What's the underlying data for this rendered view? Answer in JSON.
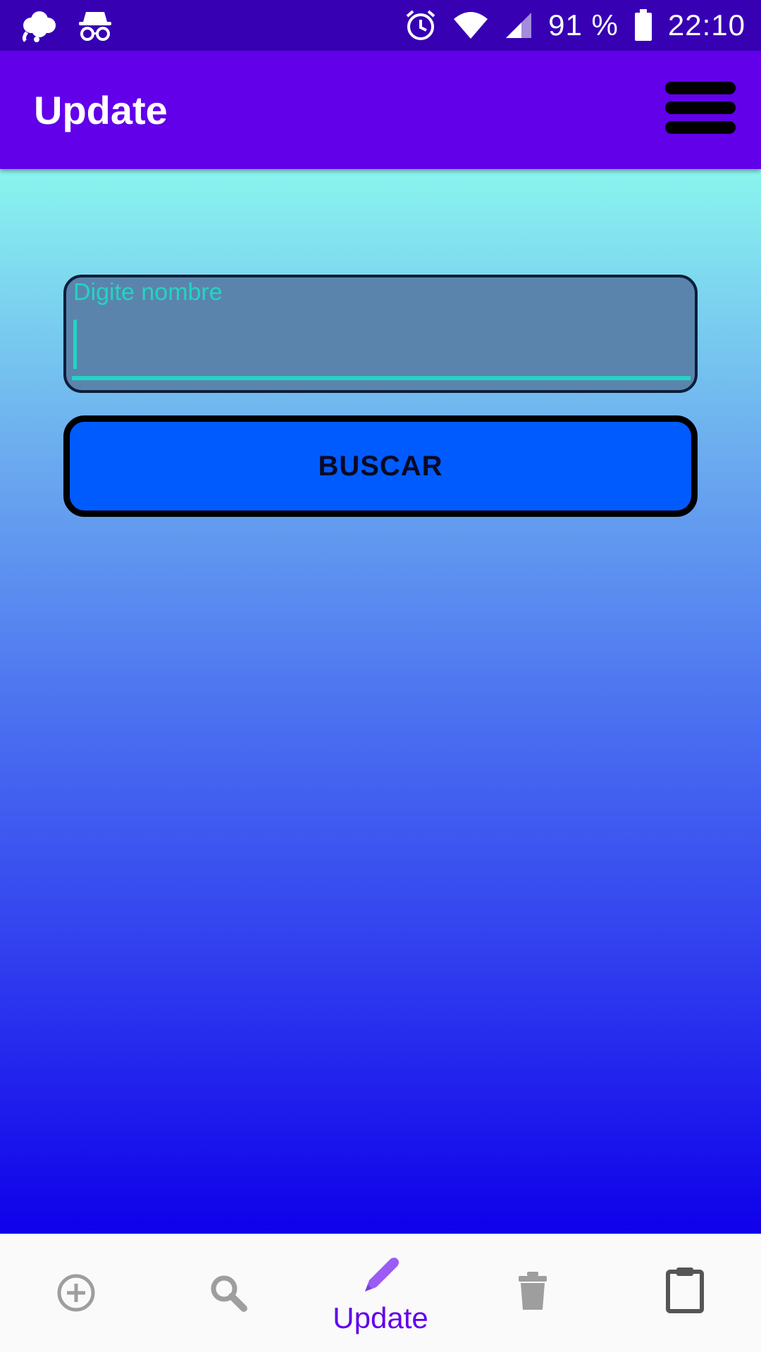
{
  "status_bar": {
    "battery_percent": "91 %",
    "time": "22:10",
    "icons": [
      "flower-notification-icon",
      "incognito-icon",
      "alarm-icon",
      "wifi-icon",
      "signal-icon",
      "battery-icon"
    ]
  },
  "app_bar": {
    "title": "Update",
    "menu_icon": "hamburger-menu-icon"
  },
  "form": {
    "name_field": {
      "placeholder": "Digite nombre",
      "value": ""
    },
    "search_button_label": "BUSCAR"
  },
  "bottom_nav": {
    "items": [
      {
        "icon": "add-circle-icon",
        "label": "",
        "selected": false
      },
      {
        "icon": "search-icon",
        "label": "",
        "selected": false
      },
      {
        "icon": "pencil-icon",
        "label": "Update",
        "selected": true
      },
      {
        "icon": "trash-icon",
        "label": "",
        "selected": false
      },
      {
        "icon": "clipboard-icon",
        "label": "",
        "selected": false
      }
    ]
  },
  "colors": {
    "status_bar": "#3700b3",
    "app_bar": "#6200ea",
    "accent": "#22d4c4",
    "button": "#005bff",
    "nav_selected": "#6200ea",
    "nav_unselected": "#9e9e9e"
  }
}
